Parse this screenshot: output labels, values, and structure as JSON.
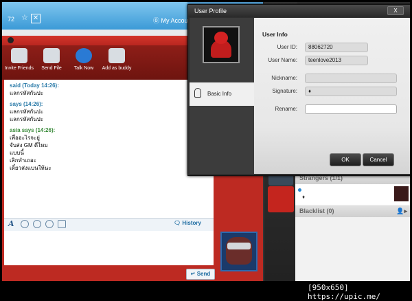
{
  "top": {
    "count": "72",
    "account_label": "My Account"
  },
  "toolbar": [
    {
      "label": "Invite Friends",
      "icon": "invite-friends-icon"
    },
    {
      "label": "Send File",
      "icon": "send-file-icon"
    },
    {
      "label": "Talk Now",
      "icon": "talk-now-icon"
    },
    {
      "label": "Add as buddy",
      "icon": "add-buddy-icon"
    }
  ],
  "messages": [
    {
      "header": "said (Today 14:26):",
      "lines": [
        "แลกรหัสกันปะ"
      ]
    },
    {
      "header": "says (14:26):",
      "lines": [
        "แลกรหัสกันปะ",
        "แลกรหัสกันปะ"
      ]
    },
    {
      "header": "asia says (14:26):",
      "lines": [
        "เพื่ออะไรจะยู่",
        "จับส่ง GM ดีไหม",
        "แบบนี้",
        "เลิกทำเถอะ",
        "เดี๋ยวส่งแบนให้นะ"
      ]
    }
  ],
  "input": {
    "history_label": "History",
    "send_label": "Send"
  },
  "contacts": {
    "strangers_label": "Strangers (1/1)",
    "blacklist_label": "Blacklist (0)",
    "stranger_signature": "♦"
  },
  "dialog": {
    "title": "User Profile",
    "close_label": "X",
    "nav_basic_info": "Basic Info",
    "section_title": "User Info",
    "user_id_label": "User ID:",
    "user_id": "88062720",
    "user_name_label": "User Name:",
    "user_name": "teenlove2013",
    "nickname_label": "Nickname:",
    "nickname": "",
    "signature_label": "Signature:",
    "signature": "♦",
    "rename_label": "Rename:",
    "rename": "",
    "ok_label": "OK",
    "cancel_label": "Cancel"
  },
  "footer": {
    "text": "[950x650] https://upic.me/"
  }
}
